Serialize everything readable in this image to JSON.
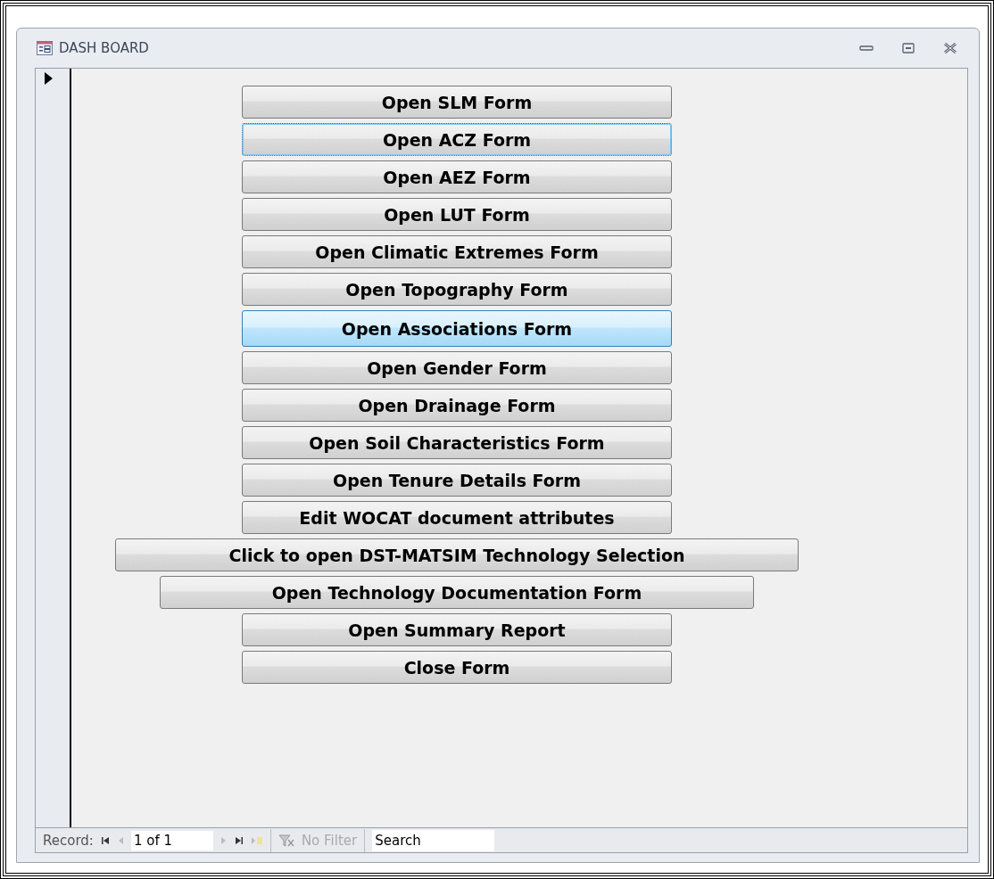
{
  "window": {
    "title": "DASH BOARD"
  },
  "buttons": [
    {
      "label": "Open SLM Form",
      "focused": false,
      "hovered": false
    },
    {
      "label": "Open ACZ Form",
      "focused": true,
      "hovered": false
    },
    {
      "label": "Open AEZ Form",
      "focused": false,
      "hovered": false
    },
    {
      "label": "Open LUT Form",
      "focused": false,
      "hovered": false
    },
    {
      "label": "Open Climatic Extremes Form",
      "focused": false,
      "hovered": false
    },
    {
      "label": "Open Topography Form",
      "focused": false,
      "hovered": false
    },
    {
      "label": "Open Associations Form",
      "focused": false,
      "hovered": true
    },
    {
      "label": "Open Gender Form",
      "focused": false,
      "hovered": false
    },
    {
      "label": "Open Drainage Form",
      "focused": false,
      "hovered": false
    },
    {
      "label": "Open Soil Characteristics Form",
      "focused": false,
      "hovered": false
    },
    {
      "label": "Open Tenure Details Form",
      "focused": false,
      "hovered": false
    },
    {
      "label": "Edit WOCAT document attributes",
      "focused": false,
      "hovered": false
    },
    {
      "label": "Click to open DST-MATSIM Technology Selection",
      "focused": false,
      "hovered": false
    },
    {
      "label": "Open Technology Documentation  Form",
      "focused": false,
      "hovered": false
    },
    {
      "label": "Open Summary Report",
      "focused": false,
      "hovered": false
    },
    {
      "label": "Close Form",
      "focused": false,
      "hovered": false
    }
  ],
  "navigation": {
    "label": "Record:",
    "position": "1 of 1",
    "filter": "No Filter",
    "search": {
      "placeholder": "Search"
    }
  }
}
